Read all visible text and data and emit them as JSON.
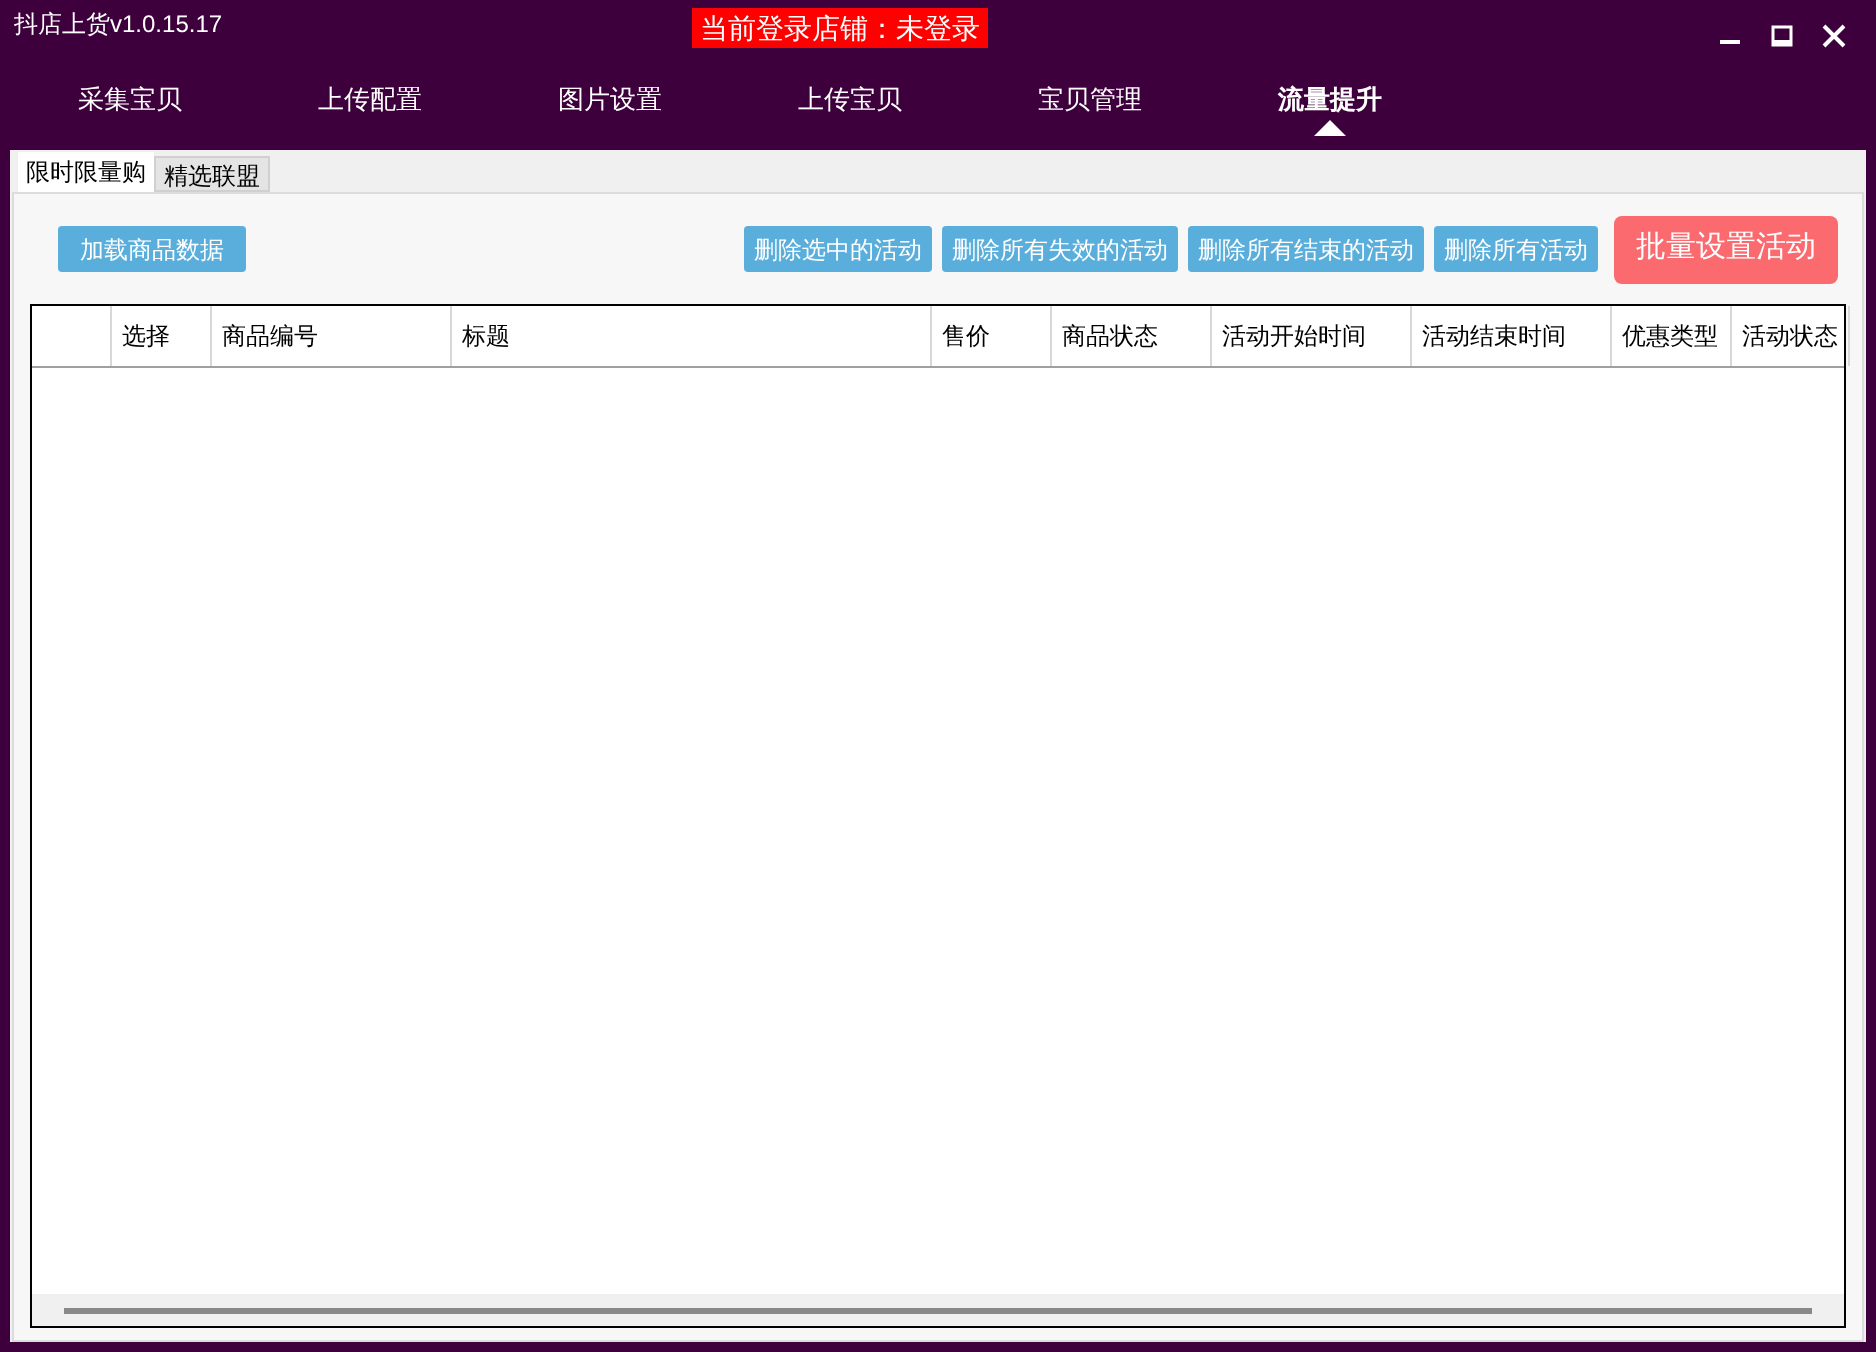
{
  "window": {
    "title": "抖店上货v1.0.15.17",
    "store_banner": "当前登录店铺：未登录"
  },
  "nav": [
    {
      "label": "采集宝贝",
      "selected": false
    },
    {
      "label": "上传配置",
      "selected": false
    },
    {
      "label": "图片设置",
      "selected": false
    },
    {
      "label": "上传宝贝",
      "selected": false
    },
    {
      "label": "宝贝管理",
      "selected": false
    },
    {
      "label": "流量提升",
      "selected": true
    }
  ],
  "tabs": [
    {
      "label": "限时限量购",
      "selected": true
    },
    {
      "label": "精选联盟",
      "selected": false
    }
  ],
  "toolbar": {
    "left": [
      "加载商品数据"
    ],
    "right": [
      "删除选中的活动",
      "删除所有失效的活动",
      "删除所有结束的活动",
      "删除所有活动"
    ],
    "primary": "批量设置活动"
  },
  "table": {
    "columns": [
      "",
      "选择",
      "商品编号",
      "标题",
      "售价",
      "商品状态",
      "活动开始时间",
      "活动结束时间",
      "优惠类型",
      "活动状态"
    ]
  }
}
